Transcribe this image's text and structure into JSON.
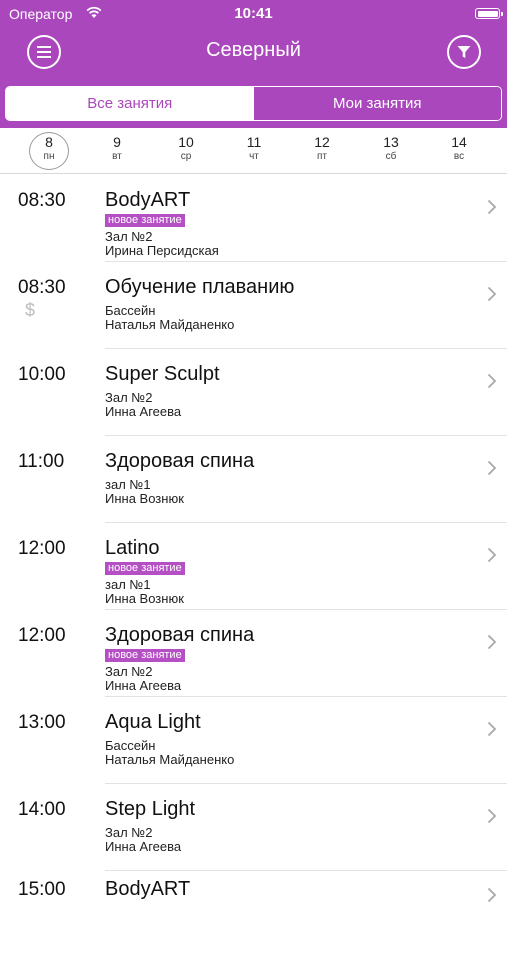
{
  "status_bar": {
    "carrier": "Оператор",
    "time": "10:41"
  },
  "header": {
    "title": "Северный",
    "menu_icon": "hamburger-icon",
    "filter_icon": "filter-icon",
    "accent_color": "#ab47bc"
  },
  "tabs": [
    {
      "label": "Все занятия",
      "active": true
    },
    {
      "label": "Мои занятия",
      "active": false
    }
  ],
  "days": [
    {
      "num": "8",
      "wd": "пн",
      "selected": true
    },
    {
      "num": "9",
      "wd": "вт",
      "selected": false
    },
    {
      "num": "10",
      "wd": "ср",
      "selected": false
    },
    {
      "num": "11",
      "wd": "чт",
      "selected": false
    },
    {
      "num": "12",
      "wd": "пт",
      "selected": false
    },
    {
      "num": "13",
      "wd": "сб",
      "selected": false
    },
    {
      "num": "14",
      "wd": "вс",
      "selected": false
    }
  ],
  "classes": [
    {
      "time": "08:30",
      "name": "BodyART",
      "badge": "новое занятие",
      "room": "Зал №2",
      "trainer": "Ирина Персидская"
    },
    {
      "time": "08:30",
      "paid_symbol": "$",
      "name": "Обучение плаванию",
      "room": "Бассейн",
      "trainer": "Наталья Майданенко"
    },
    {
      "time": "10:00",
      "name": "Super Sculpt",
      "room": "Зал №2",
      "trainer": "Инна Агеева"
    },
    {
      "time": "11:00",
      "name": "Здоровая спина",
      "room": "зал №1",
      "trainer": "Инна Вознюк"
    },
    {
      "time": "12:00",
      "name": "Latino",
      "badge": "новое занятие",
      "room": "зал №1",
      "trainer": "Инна Вознюк"
    },
    {
      "time": "12:00",
      "name": "Здоровая спина",
      "badge": "новое занятие",
      "room": "Зал №2",
      "trainer": "Инна Агеева"
    },
    {
      "time": "13:00",
      "name": "Aqua Light",
      "room": "Бассейн",
      "trainer": "Наталья Майданенко"
    },
    {
      "time": "14:00",
      "name": "Step Light",
      "room": "Зал №2",
      "trainer": "Инна Агеева"
    },
    {
      "time": "15:00",
      "name": "BodyART"
    }
  ]
}
